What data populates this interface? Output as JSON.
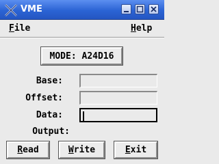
{
  "window": {
    "title": "VME"
  },
  "menu": {
    "file": {
      "first": "F",
      "rest": "ile"
    },
    "help": {
      "first": "H",
      "rest": "elp"
    }
  },
  "mode_button": {
    "label": "MODE: A24D16"
  },
  "fields": {
    "base": {
      "label": "Base:",
      "value": ""
    },
    "offset": {
      "label": "Offset:",
      "value": ""
    },
    "data": {
      "label": "Data:",
      "value": ""
    },
    "output": {
      "label": "Output:",
      "value": ""
    }
  },
  "buttons": {
    "read": {
      "first": "R",
      "rest": "ead"
    },
    "write": {
      "first": "W",
      "rest": "rite"
    },
    "exit": {
      "first": "E",
      "rest": "xit"
    }
  },
  "colors": {
    "titlebar": "#2b63d4",
    "background": "#eaeaea"
  }
}
